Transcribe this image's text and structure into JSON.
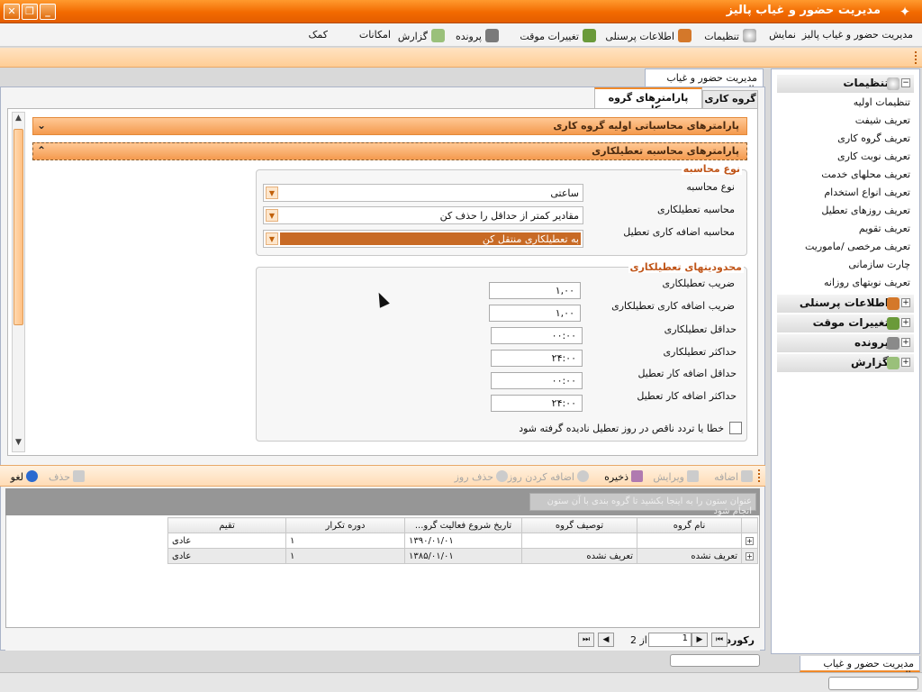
{
  "window": {
    "title": "مدیریت حضور و غیاب پالیز",
    "min": "_",
    "restore": "❐",
    "close": "✕",
    "app_icon": "✦"
  },
  "menu": [
    {
      "label": "مدیریت حضور و غیاب پالیز",
      "icon": "none"
    },
    {
      "label": "نمایش",
      "icon": "none"
    },
    {
      "label": "تنظیمات",
      "icon": "gear-icon"
    },
    {
      "label": "اطلاعات پرسنلی",
      "icon": "person-icon"
    },
    {
      "label": "تغییرات موقت",
      "icon": "people-icon"
    },
    {
      "label": "پرونده",
      "icon": "folder-icon"
    },
    {
      "label": "گزارش",
      "icon": "chart-icon"
    },
    {
      "label": "امکانات",
      "icon": "none"
    },
    {
      "label": "کمک",
      "icon": "none"
    }
  ],
  "doc_tab": "مدیریت حضور و غیاب پالیز",
  "tabs": {
    "group": "گروه کاری",
    "params": "پارامترهای گروه کاری"
  },
  "sections": {
    "s1": "پارامترهای محاسباتی اولیه گروه کاری",
    "s2": "پارامترهای محاسبه تعطیلکاری"
  },
  "calc_type": {
    "title": "نوع محاسبه",
    "fields": [
      {
        "label": "نوع محاسبه",
        "value": "ساعتی"
      },
      {
        "label": "محاسبه تعطیلکاری",
        "value": "مقادیر کمتر از حداقل را حذف کن"
      },
      {
        "label": "محاسبه اضافه کاری تعطیل",
        "value": "به تعطیلکاری منتقل کن"
      }
    ]
  },
  "limits": {
    "title": "محدودیتهای تعطیلکاری",
    "fields": [
      {
        "label": "ضریب تعطیلکاری",
        "value": "۱,۰۰"
      },
      {
        "label": "ضریب اضافه کاری تعطیلکاری",
        "value": "۱,۰۰"
      },
      {
        "label": "حداقل تعطیلکاری",
        "value": "۰۰:۰۰"
      },
      {
        "label": "حداکثر تعطیلکاری",
        "value": "۲۴:۰۰"
      },
      {
        "label": "حداقل اضافه کار تعطیل",
        "value": "۰۰:۰۰"
      },
      {
        "label": "حداکثر اضافه کار تعطیل",
        "value": "۲۴:۰۰"
      }
    ],
    "checkbox": "خطا یا تردد ناقص در روز تعطیل نادیده گرفته شود"
  },
  "toolbar": {
    "add": "اضافه",
    "edit": "ویرایش",
    "save": "ذخیره",
    "add_day": "اضافه کردن روز",
    "delete_day": "حذف روز",
    "delete": "حذف",
    "cancel": "لغو"
  },
  "group_hint": "عنوان ستون را به اینجا بکشید تا گروه بندی با آن ستون انجام شود",
  "grid": {
    "headers": [
      "نام گروه",
      "توصیف گروه",
      "تاریخ شروع فعالیت گرو...",
      "دوره تکرار",
      "تقیم"
    ],
    "rows": [
      [
        "",
        "",
        "۱۳۹۰/۰۱/۰۱",
        "۱",
        "عادی"
      ],
      [
        "تعریف نشده",
        "تعریف نشده",
        "۱۳۸۵/۰۱/۰۱",
        "۱",
        "عادی"
      ]
    ]
  },
  "pager": {
    "record": "رکورد",
    "page": "1",
    "of": "از",
    "total": "2"
  },
  "side": {
    "settings": "تنظیمات",
    "settings_items": [
      "تنظیمات اولیه",
      "تعریف شیفت",
      "تعریف گروه کاری",
      "تعریف نوبت کاری",
      "تعریف محلهای خدمت",
      "تعریف انواع استخدام",
      "تعریف روزهای تعطیل",
      "تعریف تقویم",
      "تعریف مرخصی /ماموریت",
      "چارت سازمانی",
      "تعریف نوبتهای روزانه"
    ],
    "personnel": "اطلاعات پرسنلی",
    "temp": "تغییرات موقت",
    "file": "پرونده",
    "report": "گزارش"
  },
  "bottom_tab": "مدیریت حضور و غیاب پالیز"
}
